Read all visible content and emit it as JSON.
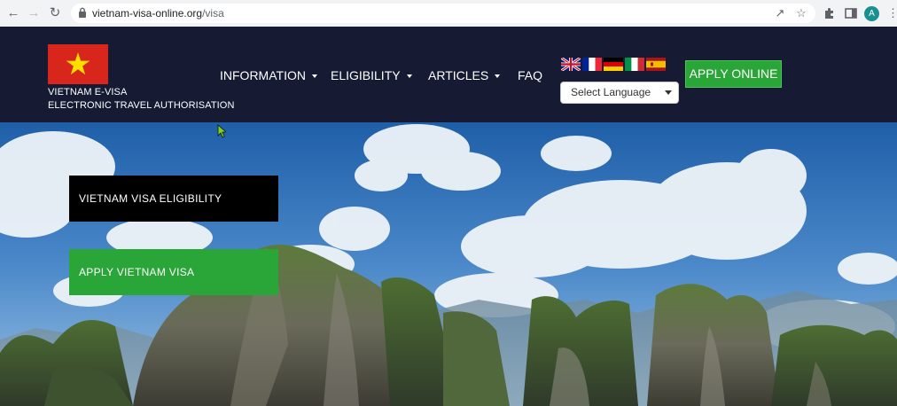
{
  "browser": {
    "url_domain": "vietnam-visa-online.org",
    "url_path": "/visa",
    "avatar_letter": "A"
  },
  "site": {
    "brand_line1": "VIETNAM E-VISA",
    "brand_line2": "ELECTRONIC TRAVEL AUTHORISATION",
    "nav": {
      "information": "INFORMATION",
      "eligibility": "ELIGIBILITY",
      "articles": "ARTICLES",
      "faq": "FAQ"
    },
    "language_select": "Select Language",
    "apply_online": "APPLY ONLINE",
    "flags": [
      "uk-flag-icon",
      "france-flag-icon",
      "germany-flag-icon",
      "italy-flag-icon",
      "spain-flag-icon"
    ]
  },
  "hero": {
    "cta_eligibility": "VIETNAM VISA ELIGIBILITY",
    "cta_apply": "APPLY VIETNAM VISA"
  },
  "colors": {
    "header_bg": "#161b33",
    "brand_green": "#2aa538",
    "flag_red": "#d8261c",
    "flag_star": "#ffde00"
  }
}
